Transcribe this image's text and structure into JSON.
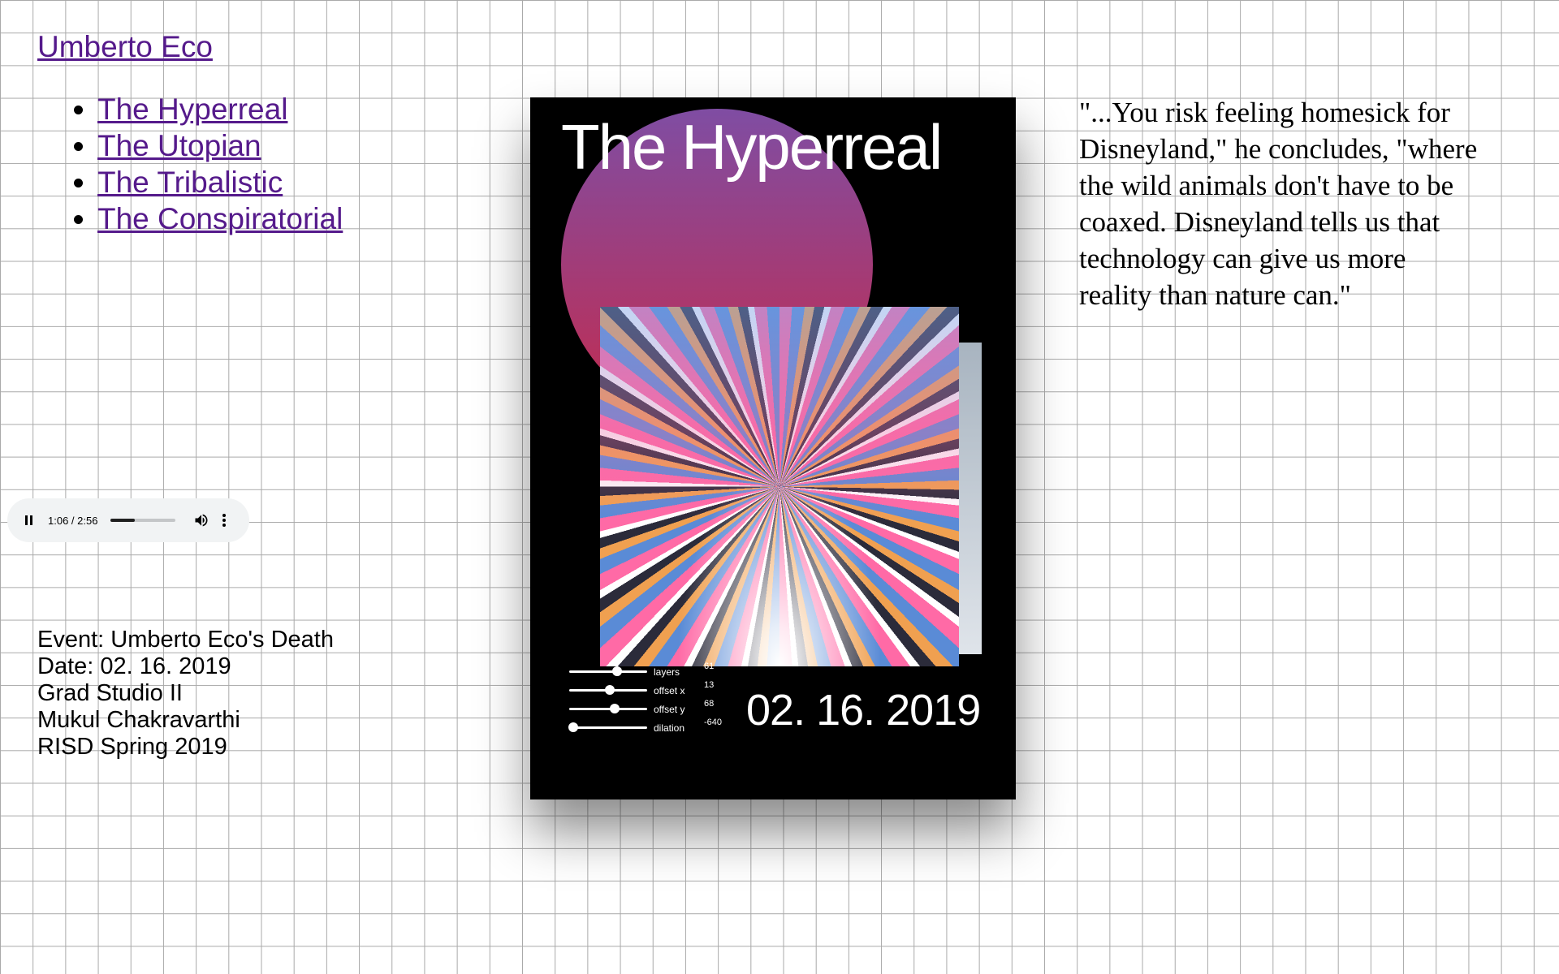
{
  "site": {
    "title": "Umberto Eco"
  },
  "nav": {
    "items": [
      {
        "label": "The Hyperreal"
      },
      {
        "label": "The Utopian"
      },
      {
        "label": "The Tribalistic"
      },
      {
        "label": "The Conspiratorial"
      }
    ]
  },
  "audio": {
    "time": "1:06 / 2:56",
    "progress_fraction": 0.375,
    "icons": {
      "pause": "pause-icon",
      "volume": "volume-icon",
      "more": "more-vert-icon"
    }
  },
  "info": {
    "lines": [
      "Event: Umberto Eco's Death",
      "Date: 02. 16. 2019",
      "Grad Studio II",
      "Mukul Chakravarthi",
      "RISD Spring 2019"
    ]
  },
  "poster": {
    "title": "The Hyperreal",
    "date": "02. 16. 2019",
    "controls": [
      {
        "label": "layers",
        "value": "61",
        "fraction": 0.61
      },
      {
        "label": "offset x",
        "value": "13",
        "fraction": 0.52
      },
      {
        "label": "offset y",
        "value": "68",
        "fraction": 0.58
      },
      {
        "label": "dilation",
        "value": "-640",
        "fraction": 0.05
      }
    ]
  },
  "quote": {
    "text": "\"...You risk feeling homesick for Disneyland,\" he concludes, \"where the wild animals don't have to be coaxed. Disneyland tells us that technology can give us more reality than nature can.\""
  },
  "colors": {
    "grid": "#a9a9a9",
    "link": "#551a8b",
    "poster_bg": "#000000",
    "circle_top": "#7f4da3",
    "circle_bottom": "#c6284a"
  }
}
